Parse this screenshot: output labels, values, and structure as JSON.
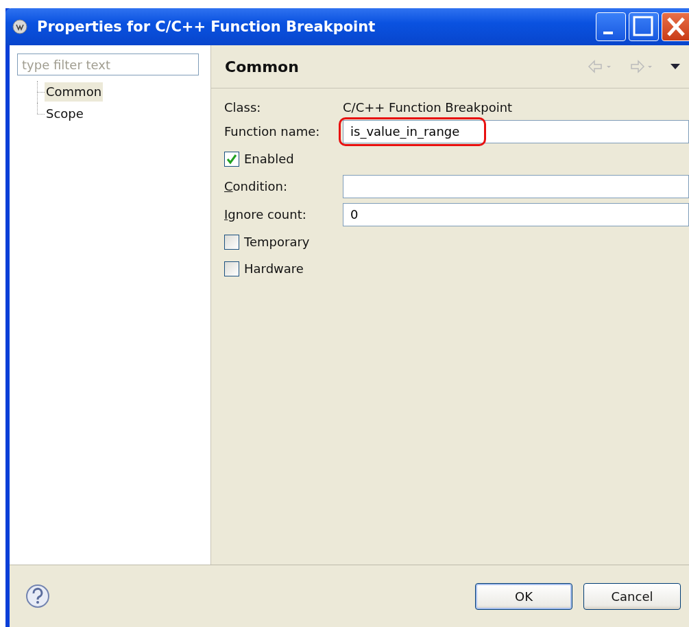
{
  "window": {
    "title": "Properties for C/C++ Function Breakpoint"
  },
  "sidebar": {
    "filter": {
      "placeholder": "type filter text"
    },
    "items": [
      {
        "label": "Common",
        "selected": true
      },
      {
        "label": "Scope",
        "selected": false
      }
    ]
  },
  "page": {
    "title": "Common"
  },
  "form": [
    {
      "kind": "info",
      "label": "Class:",
      "value": "C/C++ Function Breakpoint"
    },
    {
      "kind": "field",
      "label": "Function name:",
      "value": "is_value_in_range",
      "highlighted": true
    },
    {
      "kind": "checkbox",
      "label": "Enabled",
      "checked": true
    },
    {
      "kind": "field",
      "label": "Condition:",
      "mnemonic_underlined": true
    },
    {
      "kind": "field",
      "label": "Ignore count:",
      "mnemonic_underlined": true,
      "value": "0"
    },
    {
      "kind": "checkbox",
      "label": "Temporary",
      "checked": false
    },
    {
      "kind": "checkbox",
      "label": "Hardware",
      "checked": false
    }
  ],
  "buttons": [
    "OK",
    "Cancel"
  ]
}
